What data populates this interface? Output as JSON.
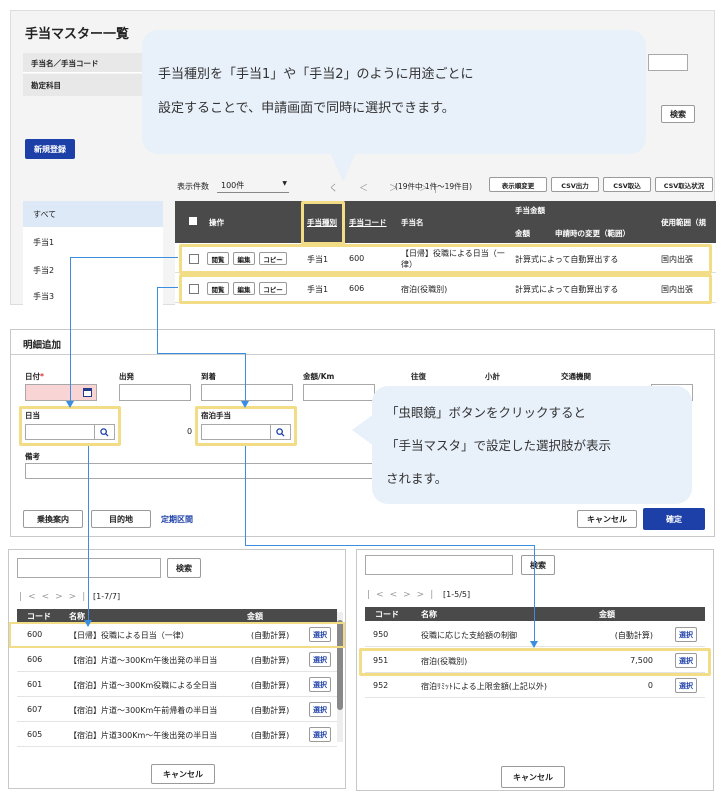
{
  "top": {
    "title": "手当マスター一覧",
    "filters": [
      "手当名／手当コード",
      "勘定科目"
    ],
    "search": "検索",
    "new": "新規登録",
    "count_label": "表示件数",
    "count_value": "100件",
    "nav": "く　＜　＞　＞|",
    "range": "(19件中 1件〜19件目)",
    "tools": [
      "表示順変更",
      "CSV出力",
      "CSV取込",
      "CSV取込状況"
    ],
    "left_items": [
      "すべて",
      "手当1",
      "手当2",
      "手当3"
    ],
    "headers": {
      "ops": "操作",
      "type": "手当種別",
      "code": "手当コード",
      "name": "手当名",
      "amount": "手当金額",
      "sub_amount": "金額",
      "sub_change": "申請時の変更（範囲）",
      "scope": "使用範囲（規"
    },
    "row_buttons": [
      "閲覧",
      "編集",
      "コピー"
    ],
    "rows": [
      {
        "type": "手当1",
        "code": "600",
        "name": "【日帰】役職による日当（一律）",
        "amount": "計算式によって自動算出する",
        "scope": "国内出張"
      },
      {
        "type": "手当1",
        "code": "606",
        "name": "宿泊(役職別)",
        "amount": "計算式によって自動算出する",
        "scope": "国内出張"
      }
    ]
  },
  "bubble1": [
    "手当種別を「手当1」や「手当2」のように用途ごとに",
    "設定することで、申請画面で同時に選択できます。"
  ],
  "mid": {
    "title": "明細追加",
    "labels": {
      "date": "日付",
      "depart": "出発",
      "arrive": "到着",
      "amount": "金額/Km",
      "round": "往復",
      "subtotal": "小計",
      "transport": "交通機関",
      "daily": "日当",
      "lodging": "宿泊手当",
      "note": "備考"
    },
    "required_mark": "*",
    "zero": "0",
    "buttons": {
      "transfer": "乗換案内",
      "destination": "目的地",
      "commuter": "定期区間",
      "cancel": "キャンセル",
      "confirm": "確定"
    }
  },
  "bubble2": [
    "「虫眼鏡」ボタンをクリックすると",
    "「手当マスタ」で設定した選択肢が表示",
    "されます。"
  ],
  "left_modal": {
    "search": "検索",
    "range": "[1-7/7]",
    "headers": {
      "code": "コード",
      "name": "名称",
      "amount": "金額"
    },
    "rows": [
      {
        "code": "600",
        "name": "【日帰】役職による日当（一律）",
        "amount": "(自動計算)"
      },
      {
        "code": "606",
        "name": "【宿泊】片道〜300Km午後出発の半日当",
        "amount": "(自動計算)"
      },
      {
        "code": "601",
        "name": "【宿泊】片道〜300Km役職による全日当",
        "amount": "(自動計算)"
      },
      {
        "code": "607",
        "name": "【宿泊】片道〜300Km午前帰着の半日当",
        "amount": "(自動計算)"
      },
      {
        "code": "605",
        "name": "【宿泊】片道300Km〜午後出発の半日当",
        "amount": "(自動計算)"
      }
    ],
    "select": "選択",
    "cancel": "キャンセル"
  },
  "right_modal": {
    "search": "検索",
    "range": "[1-5/5]",
    "headers": {
      "code": "コード",
      "name": "名称",
      "amount": "金額"
    },
    "rows": [
      {
        "code": "950",
        "name": "役職に応じた支給額の制御",
        "amount": "(自動計算)"
      },
      {
        "code": "951",
        "name": "宿泊(役職別)",
        "amount": "7,500"
      },
      {
        "code": "952",
        "name": "宿泊ﾘﾐｯﾄによる上限金額(上記以外)",
        "amount": "0"
      }
    ],
    "select": "選択",
    "cancel": "キャンセル"
  },
  "colors": {
    "primary": "#1c3fa8",
    "highlight": "#f2dc86",
    "bubble": "#e8f0fa",
    "connector": "#3a8de0"
  }
}
